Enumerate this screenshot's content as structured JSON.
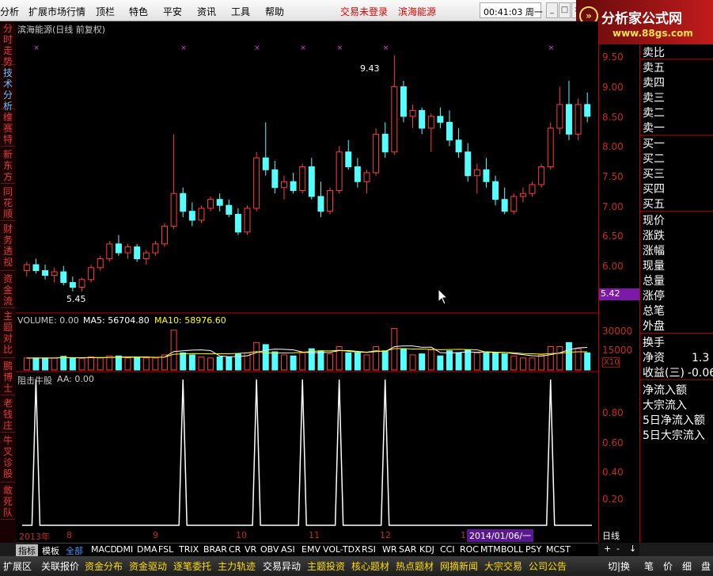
{
  "menu": {
    "items": [
      "分析",
      "扩展市场行情",
      "顶栏",
      "特色",
      "平安",
      "资讯",
      "工具",
      "帮助"
    ],
    "login_status": "交易未登录",
    "stock_name": "滨海能源",
    "clock": "00:41:03 周一"
  },
  "window_buttons": [
    "_",
    "□",
    "×"
  ],
  "brand": {
    "title": "分析家公式网",
    "url": "www.88gs.com"
  },
  "left_tabs": [
    "分时走势",
    "技术分析",
    "维赛特",
    "新东方",
    "同花顺",
    "财务透视",
    "资金流",
    "主题对比",
    "鹏博士",
    "老钱庄",
    "牛叉诊股",
    "敢死队"
  ],
  "main_chart": {
    "title": "滨海能源(日线 前复权)",
    "high_label": "9.43",
    "low_label": "5.45",
    "price_ticks": [
      "9.50",
      "9.00",
      "8.50",
      "8.00",
      "7.50",
      "7.00",
      "6.50",
      "6.00",
      "5.42"
    ],
    "current_price": "5.42"
  },
  "volume_panel": {
    "label": "VOLUME: 0.00",
    "ma5": "MA5: 56704.80",
    "ma10": "MA10: 58976.60",
    "ticks": [
      "30000",
      "15000"
    ],
    "unit": "X10"
  },
  "indicator_panel": {
    "label": "阻击牛股",
    "aa": "AA: 0.00",
    "ticks": [
      "0.80",
      "0.60",
      "0.40",
      "0.20"
    ]
  },
  "x_axis": {
    "labels": [
      "2013年",
      "8",
      "9",
      "10",
      "11",
      "12",
      "1"
    ],
    "cursor_date": "2014/01/06/一",
    "period": "日线"
  },
  "right_panel": {
    "order_book": [
      "卖比",
      "卖五",
      "卖四",
      "卖三",
      "卖二",
      "卖一",
      "买一",
      "买二",
      "买三",
      "买四",
      "买五"
    ],
    "stats": [
      "现价",
      "涨跌",
      "涨幅",
      "现量",
      "总量",
      "涨停",
      "总笔",
      "外盘",
      "换手"
    ],
    "net_asset_label": "净资",
    "net_asset_value": "1.3",
    "eps_label": "收益(三)",
    "eps_value": "-0.06",
    "flows": [
      "净流入额",
      "大宗流入",
      "5日净流入额",
      "5日大宗流入"
    ]
  },
  "indicator_tabs": [
    "指标",
    "模板",
    "全部",
    "MACD",
    "DMI",
    "DMA",
    "FSL",
    "TRIX",
    "BRAR",
    "CR",
    "VR",
    "OBV",
    "ASI",
    "EMV",
    "VOL-TDX",
    "RSI",
    "WR",
    "SAR",
    "KDJ",
    "CCI",
    "ROC",
    "MTM",
    "BOLL",
    "PSY",
    "MCST"
  ],
  "function_tabs": [
    "扩展区",
    "关联报价",
    "资金分布",
    "资金驱动",
    "逐笔委托",
    "主力轨迹",
    "交易异动",
    "主题投资",
    "核心题材",
    "热点题材",
    "网摘新闻",
    "大宗交易",
    "公司公告"
  ],
  "bottom_right": {
    "switch": "切|换",
    "scroll": [
      "+",
      "-",
      "↓"
    ],
    "mini_tabs": [
      "笔",
      "价",
      "细",
      "盘"
    ]
  },
  "colors": {
    "up": "#ff3c3c",
    "down": "#54ffff",
    "ma5": "#ffffff",
    "ma10": "#ffff00",
    "frame": "#c00000"
  },
  "chart_data": {
    "type": "candlestick",
    "title": "滨海能源(日线 前复权)",
    "price_range": [
      5.3,
      9.6
    ],
    "candles": [
      [
        5.8,
        5.95,
        5.7,
        5.9
      ],
      [
        5.9,
        6.0,
        5.75,
        5.8
      ],
      [
        5.8,
        5.9,
        5.65,
        5.72
      ],
      [
        5.72,
        5.85,
        5.6,
        5.78
      ],
      [
        5.78,
        5.88,
        5.55,
        5.6
      ],
      [
        5.6,
        5.7,
        5.45,
        5.52
      ],
      [
        5.52,
        5.68,
        5.45,
        5.65
      ],
      [
        5.65,
        5.9,
        5.6,
        5.85
      ],
      [
        5.85,
        6.05,
        5.8,
        6.0
      ],
      [
        6.0,
        6.3,
        5.95,
        6.25
      ],
      [
        6.25,
        6.4,
        6.05,
        6.1
      ],
      [
        6.1,
        6.25,
        6.0,
        6.2
      ],
      [
        6.2,
        6.25,
        5.95,
        6.0
      ],
      [
        6.0,
        6.15,
        5.9,
        6.1
      ],
      [
        6.1,
        6.3,
        6.05,
        6.25
      ],
      [
        6.25,
        6.6,
        6.2,
        6.55
      ],
      [
        6.55,
        8.1,
        6.5,
        7.1
      ],
      [
        7.1,
        7.2,
        6.7,
        6.8
      ],
      [
        6.8,
        6.95,
        6.55,
        6.65
      ],
      [
        6.65,
        6.9,
        6.6,
        6.85
      ],
      [
        6.85,
        7.05,
        6.8,
        7.0
      ],
      [
        7.0,
        7.1,
        6.8,
        6.9
      ],
      [
        6.9,
        7.0,
        6.7,
        6.75
      ],
      [
        6.75,
        6.85,
        6.4,
        6.45
      ],
      [
        6.45,
        6.9,
        6.4,
        6.85
      ],
      [
        6.85,
        7.8,
        6.8,
        7.7
      ],
      [
        7.7,
        8.3,
        7.4,
        7.5
      ],
      [
        7.5,
        7.65,
        7.1,
        7.2
      ],
      [
        7.2,
        7.4,
        7.0,
        7.3
      ],
      [
        7.3,
        7.45,
        7.1,
        7.15
      ],
      [
        7.15,
        7.6,
        7.1,
        7.55
      ],
      [
        7.55,
        7.7,
        7.0,
        7.05
      ],
      [
        7.05,
        7.3,
        6.7,
        6.8
      ],
      [
        6.8,
        7.2,
        6.75,
        7.15
      ],
      [
        7.15,
        7.9,
        7.1,
        7.8
      ],
      [
        7.8,
        8.0,
        7.5,
        7.55
      ],
      [
        7.55,
        7.7,
        7.2,
        7.3
      ],
      [
        7.3,
        7.5,
        7.1,
        7.45
      ],
      [
        7.45,
        8.2,
        7.4,
        8.1
      ],
      [
        8.1,
        8.3,
        7.7,
        7.8
      ],
      [
        7.8,
        9.43,
        7.75,
        8.9
      ],
      [
        8.9,
        9.0,
        8.3,
        8.4
      ],
      [
        8.4,
        8.6,
        8.2,
        8.5
      ],
      [
        8.5,
        8.55,
        8.1,
        8.2
      ],
      [
        8.2,
        8.45,
        7.8,
        8.4
      ],
      [
        8.4,
        8.55,
        8.2,
        8.3
      ],
      [
        8.3,
        8.5,
        7.9,
        8.0
      ],
      [
        8.0,
        8.2,
        7.7,
        7.8
      ],
      [
        7.8,
        7.95,
        7.3,
        7.4
      ],
      [
        7.4,
        7.6,
        7.1,
        7.5
      ],
      [
        7.5,
        7.7,
        7.2,
        7.3
      ],
      [
        7.3,
        7.4,
        6.9,
        7.0
      ],
      [
        7.0,
        7.2,
        6.75,
        6.8
      ],
      [
        6.8,
        7.1,
        6.75,
        7.05
      ],
      [
        7.05,
        7.2,
        6.95,
        7.1
      ],
      [
        7.1,
        7.3,
        7.05,
        7.25
      ],
      [
        7.25,
        7.6,
        7.2,
        7.55
      ],
      [
        7.55,
        8.3,
        7.5,
        8.2
      ],
      [
        8.2,
        8.9,
        8.1,
        8.6
      ],
      [
        8.6,
        9.0,
        8.0,
        8.1
      ],
      [
        8.1,
        8.7,
        8.0,
        8.6
      ],
      [
        8.6,
        8.8,
        8.3,
        8.4
      ]
    ],
    "volume_y_ticks": [
      30000,
      15000
    ],
    "indicator_signals_at_candles": [
      1,
      17,
      25,
      30,
      34,
      39,
      57
    ],
    "indicator_y_ticks": [
      0.8,
      0.6,
      0.4,
      0.2
    ]
  }
}
